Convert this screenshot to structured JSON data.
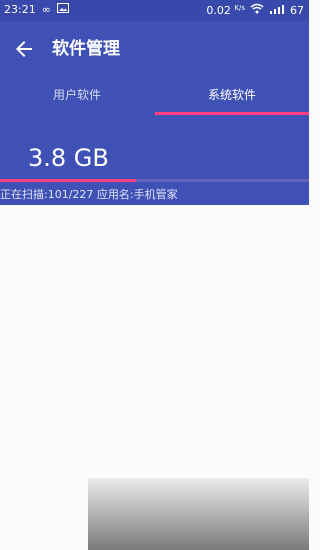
{
  "status_bar": {
    "time": "23:21",
    "infinity_icon": "infinity-icon",
    "image_icon": "image-icon",
    "network_speed": "0.02",
    "network_speed_unit": "K/s",
    "wifi_icon": "wifi-icon",
    "signal_icon": "signal-icon",
    "battery": "67"
  },
  "app_bar": {
    "back_icon": "back-arrow-icon",
    "title": "软件管理"
  },
  "tabs": [
    {
      "label": "用户软件",
      "selected": false
    },
    {
      "label": "系统软件",
      "selected": true
    }
  ],
  "summary": {
    "size": "3.8 GB",
    "scan_text": "正在扫描:101/227 应用名:手机管家",
    "progress": 0.44
  },
  "colors": {
    "primary": "#3f51b5",
    "status_bar": "#3949ab",
    "accent": "#ff4081",
    "content_bg": "#fbfafc"
  }
}
